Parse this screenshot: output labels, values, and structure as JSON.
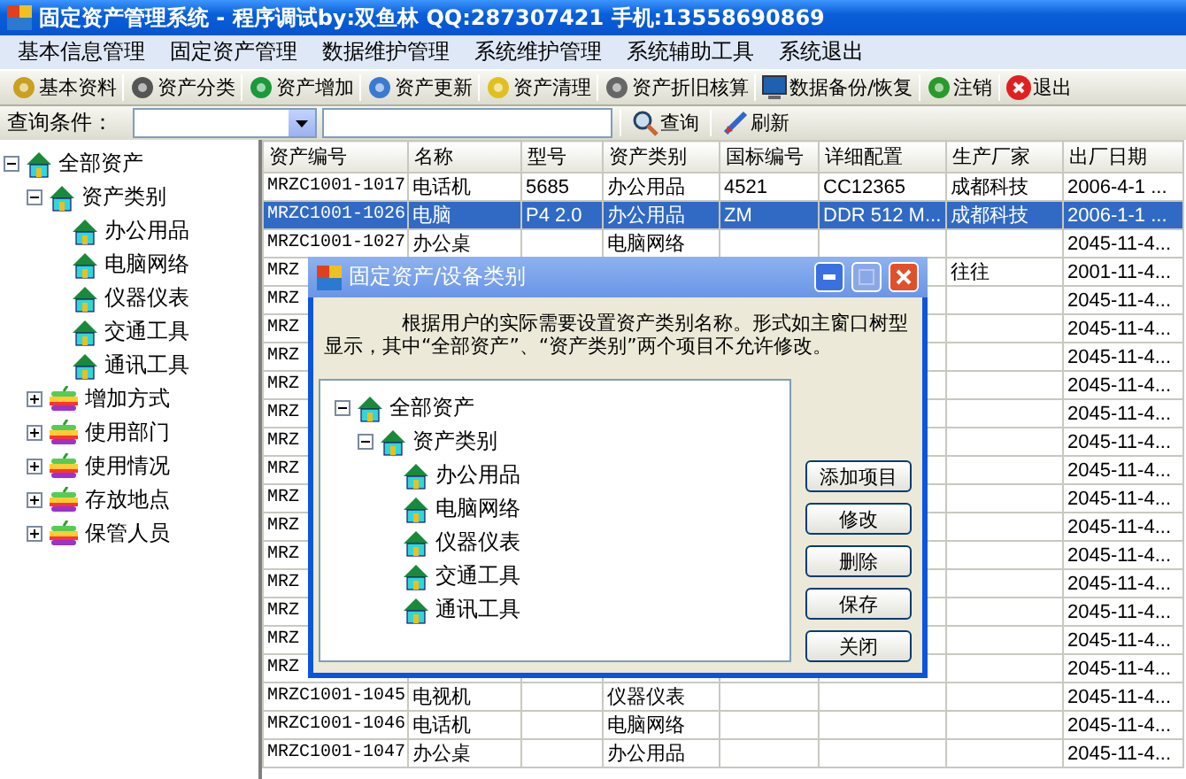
{
  "window": {
    "title": "固定资产管理系统 - 程序调试by:双鱼林 QQ:287307421 手机:13558690869"
  },
  "menu": [
    "基本信息管理",
    "固定资产管理",
    "数据维护管理",
    "系统维护管理",
    "系统辅助工具",
    "系统退出"
  ],
  "toolbar": [
    "基本资料",
    "资产分类",
    "资产增加",
    "资产更新",
    "资产清理",
    "资产折旧核算",
    "数据备份/恢复",
    "注销",
    "退出"
  ],
  "query": {
    "label": "查询条件：",
    "buttons": [
      "查询",
      "刷新"
    ]
  },
  "tree": [
    {
      "label": "全部资产",
      "kind": "house",
      "expanded": true,
      "children": [
        {
          "label": "资产类别",
          "kind": "house",
          "expanded": true,
          "children": [
            {
              "label": "办公用品",
              "kind": "house"
            },
            {
              "label": "电脑网络",
              "kind": "house"
            },
            {
              "label": "仪器仪表",
              "kind": "house"
            },
            {
              "label": "交通工具",
              "kind": "house"
            },
            {
              "label": "通讯工具",
              "kind": "house"
            }
          ]
        },
        {
          "label": "增加方式",
          "kind": "apple",
          "expanded": false
        },
        {
          "label": "使用部门",
          "kind": "apple",
          "expanded": false
        },
        {
          "label": "使用情况",
          "kind": "apple",
          "expanded": false
        },
        {
          "label": "存放地点",
          "kind": "apple",
          "expanded": false
        },
        {
          "label": "保管人员",
          "kind": "apple",
          "expanded": false
        }
      ]
    }
  ],
  "table": {
    "columns": [
      "资产编号",
      "名称",
      "型号",
      "资产类别",
      "国标编号",
      "详细配置",
      "生产厂家",
      "出厂日期"
    ],
    "rows": [
      {
        "selected": false,
        "cells": [
          "MRZC1001-1017",
          "电话机",
          "5685",
          "办公用品",
          "4521",
          "CC12365",
          "成都科技",
          "2006-4-1 ..."
        ]
      },
      {
        "selected": true,
        "cells": [
          "MRZC1001-1026",
          "电脑",
          "P4 2.0",
          "办公用品",
          "ZM",
          "DDR 512 M...",
          "成都科技",
          "2006-1-1 ..."
        ]
      },
      {
        "selected": false,
        "cells": [
          "MRZC1001-1027",
          "办公桌",
          null,
          "电脑网络",
          null,
          null,
          null,
          "2045-11-4..."
        ]
      },
      {
        "selected": false,
        "cells": [
          "MRZ",
          null,
          null,
          null,
          null,
          null,
          "往往",
          "2001-11-4..."
        ]
      },
      {
        "selected": false,
        "cells": [
          "MRZ",
          null,
          null,
          null,
          null,
          null,
          null,
          "2045-11-4..."
        ]
      },
      {
        "selected": false,
        "cells": [
          "MRZ",
          null,
          null,
          null,
          null,
          null,
          null,
          "2045-11-4..."
        ]
      },
      {
        "selected": false,
        "cells": [
          "MRZ",
          null,
          null,
          null,
          null,
          null,
          null,
          "2045-11-4..."
        ]
      },
      {
        "selected": false,
        "cells": [
          "MRZ",
          null,
          null,
          null,
          null,
          null,
          null,
          "2045-11-4..."
        ]
      },
      {
        "selected": false,
        "cells": [
          "MRZ",
          null,
          null,
          null,
          null,
          null,
          null,
          "2045-11-4..."
        ]
      },
      {
        "selected": false,
        "cells": [
          "MRZ",
          null,
          null,
          null,
          null,
          null,
          null,
          "2045-11-4..."
        ]
      },
      {
        "selected": false,
        "cells": [
          "MRZ",
          null,
          null,
          null,
          null,
          null,
          null,
          "2045-11-4..."
        ]
      },
      {
        "selected": false,
        "cells": [
          "MRZ",
          null,
          null,
          null,
          null,
          null,
          null,
          "2045-11-4..."
        ]
      },
      {
        "selected": false,
        "cells": [
          "MRZ",
          null,
          null,
          null,
          null,
          null,
          null,
          "2045-11-4..."
        ]
      },
      {
        "selected": false,
        "cells": [
          "MRZ",
          null,
          null,
          null,
          null,
          null,
          null,
          "2045-11-4..."
        ]
      },
      {
        "selected": false,
        "cells": [
          "MRZ",
          null,
          null,
          null,
          null,
          null,
          null,
          "2045-11-4..."
        ]
      },
      {
        "selected": false,
        "cells": [
          "MRZ",
          null,
          null,
          null,
          null,
          null,
          null,
          "2045-11-4..."
        ]
      },
      {
        "selected": false,
        "cells": [
          "MRZ",
          null,
          null,
          null,
          null,
          null,
          null,
          "2045-11-4..."
        ]
      },
      {
        "selected": false,
        "cells": [
          "MRZ",
          null,
          null,
          null,
          null,
          null,
          null,
          "2045-11-4..."
        ]
      },
      {
        "selected": false,
        "cells": [
          "MRZC1001-1045",
          "电视机",
          null,
          "仪器仪表",
          null,
          null,
          null,
          "2045-11-4..."
        ]
      },
      {
        "selected": false,
        "cells": [
          "MRZC1001-1046",
          "电话机",
          null,
          "电脑网络",
          null,
          null,
          null,
          "2045-11-4..."
        ]
      },
      {
        "selected": false,
        "cells": [
          "MRZC1001-1047",
          "办公桌",
          null,
          "办公用品",
          null,
          null,
          null,
          "2045-11-4..."
        ]
      }
    ]
  },
  "dialog": {
    "title": "固定资产/设备类别",
    "description": "根据用户的实际需要设置资产类别名称。形式如主窗口树型显示，其中“全部资产”、“资产类别”两个项目不允许修改。",
    "tree": [
      {
        "label": "全部资产",
        "kind": "house",
        "expanded": true,
        "children": [
          {
            "label": "资产类别",
            "kind": "house",
            "expanded": true,
            "children": [
              {
                "label": "办公用品",
                "kind": "house"
              },
              {
                "label": "电脑网络",
                "kind": "house"
              },
              {
                "label": "仪器仪表",
                "kind": "house"
              },
              {
                "label": "交通工具",
                "kind": "house"
              },
              {
                "label": "通讯工具",
                "kind": "house"
              }
            ]
          }
        ]
      }
    ],
    "buttons": [
      "添加项目",
      "修改",
      "删除",
      "保存",
      "关闭"
    ]
  }
}
